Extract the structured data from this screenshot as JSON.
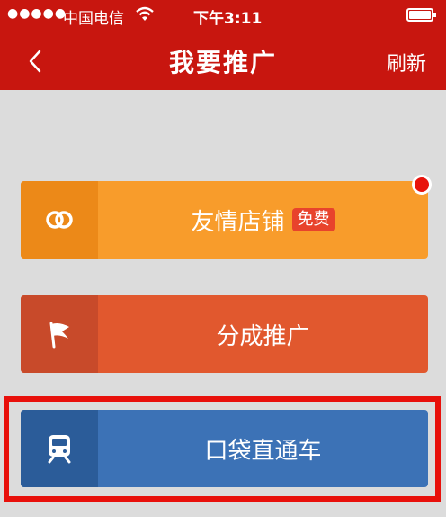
{
  "status_bar": {
    "signal": "●●●●●",
    "carrier": "中国电信",
    "time": "下午3:11"
  },
  "nav": {
    "title": "我要推广",
    "refresh_label": "刷新"
  },
  "cards": [
    {
      "label": "友情店铺",
      "badge": "免费",
      "icon": "rings-icon",
      "color": "#f89c2b"
    },
    {
      "label": "分成推广",
      "icon": "flag-icon",
      "color": "#e1582e"
    },
    {
      "label": "口袋直通车",
      "icon": "train-icon",
      "color": "#3c72b6"
    }
  ],
  "colors": {
    "header": "#c8160f",
    "background": "#dcdcdc",
    "highlight": "#e8100b"
  }
}
